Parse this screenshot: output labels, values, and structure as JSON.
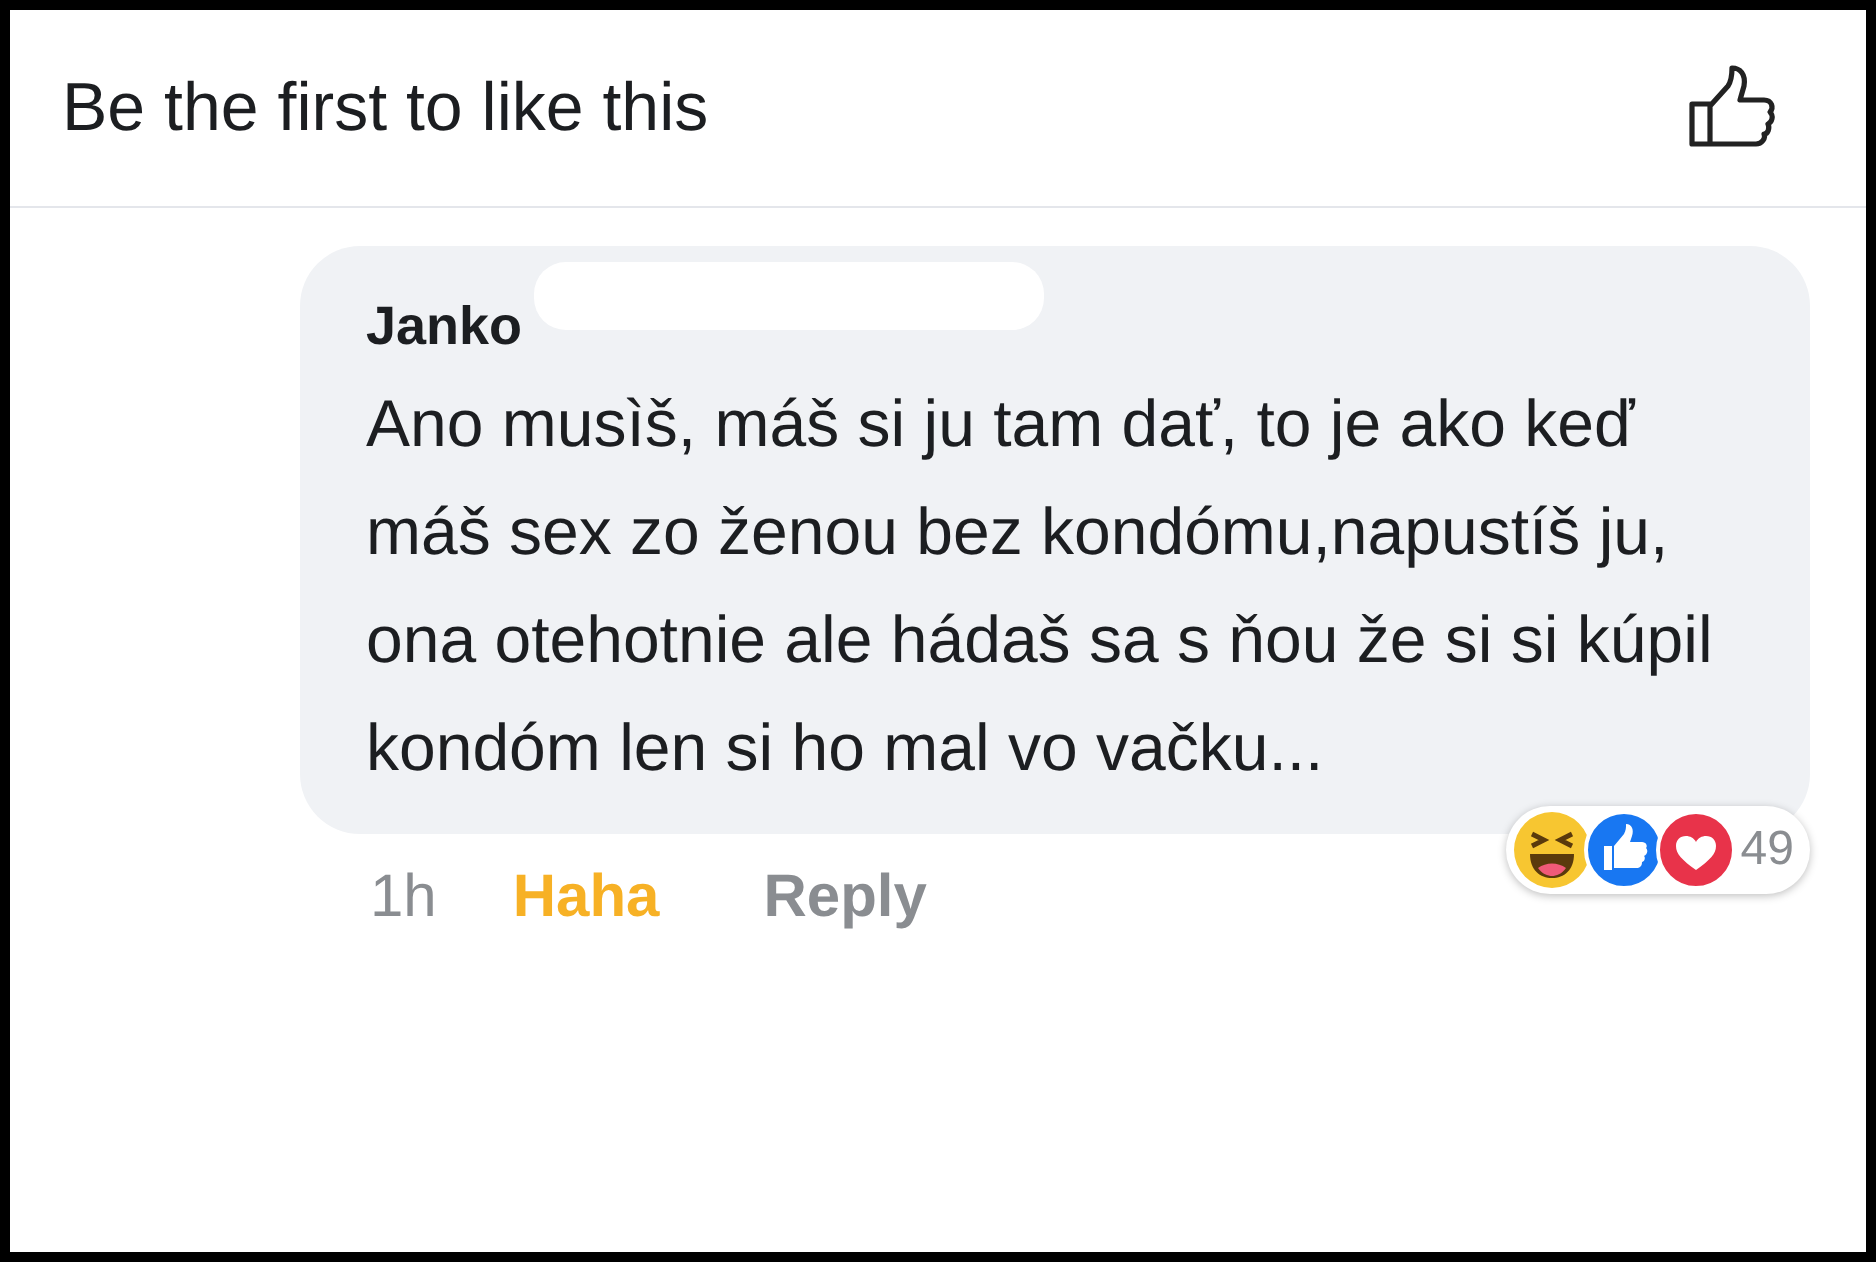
{
  "likes_bar": {
    "text": "Be the first to like this"
  },
  "comment": {
    "author": "Janko",
    "author_redacted": true,
    "text": "Ano musìš, máš si ju tam dať, to je ako keď máš sex zo ženou bez kondómu,napustíš ju, ona otehotnie ale hádaš sa s ňou že si si kúpil kondóm len si ho mal vo vačku...",
    "time": "1h",
    "actions": [
      {
        "label": "Haha",
        "selected": true
      },
      {
        "label": "Reply",
        "selected": false
      }
    ],
    "reactions": [
      {
        "kind": "haha"
      },
      {
        "kind": "like"
      },
      {
        "kind": "love"
      }
    ],
    "reaction_count": "49"
  }
}
